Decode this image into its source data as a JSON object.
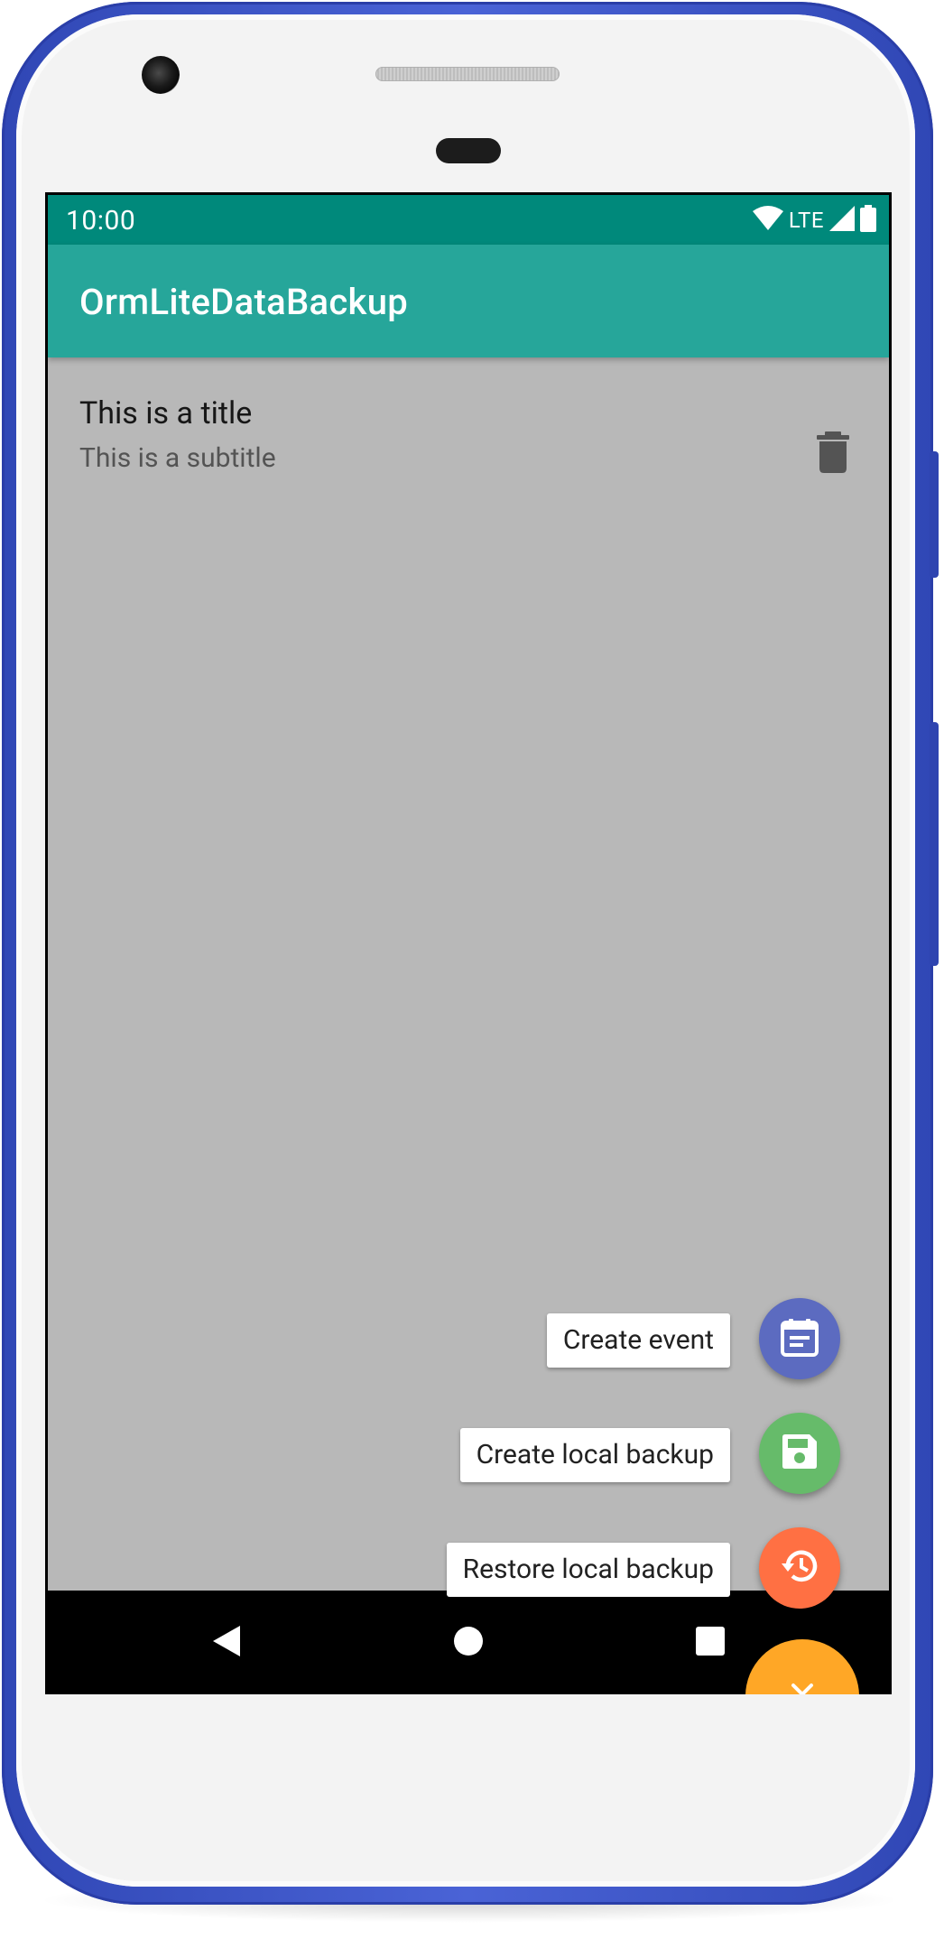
{
  "status_bar": {
    "time": "10:00",
    "network": "LTE",
    "color": "#00897b"
  },
  "app_bar": {
    "title": "OrmLiteDataBackup",
    "color": "#26a69a"
  },
  "list": {
    "items": [
      {
        "title": "This is a title",
        "subtitle": "This is a subtitle",
        "action_icon": "trash-icon"
      }
    ]
  },
  "speed_dial": {
    "actions": [
      {
        "label": "Create event",
        "icon": "calendar-icon",
        "color": "#5c6bc0"
      },
      {
        "label": "Create local backup",
        "icon": "save-icon",
        "color": "#66bb6a"
      },
      {
        "label": "Restore local backup",
        "icon": "restore-icon",
        "color": "#ff7043"
      }
    ],
    "main": {
      "icon": "close-icon",
      "color": "#ffa726",
      "expanded": true
    }
  },
  "nav_bar": {
    "buttons": [
      "back-icon",
      "home-icon",
      "recents-icon"
    ]
  }
}
